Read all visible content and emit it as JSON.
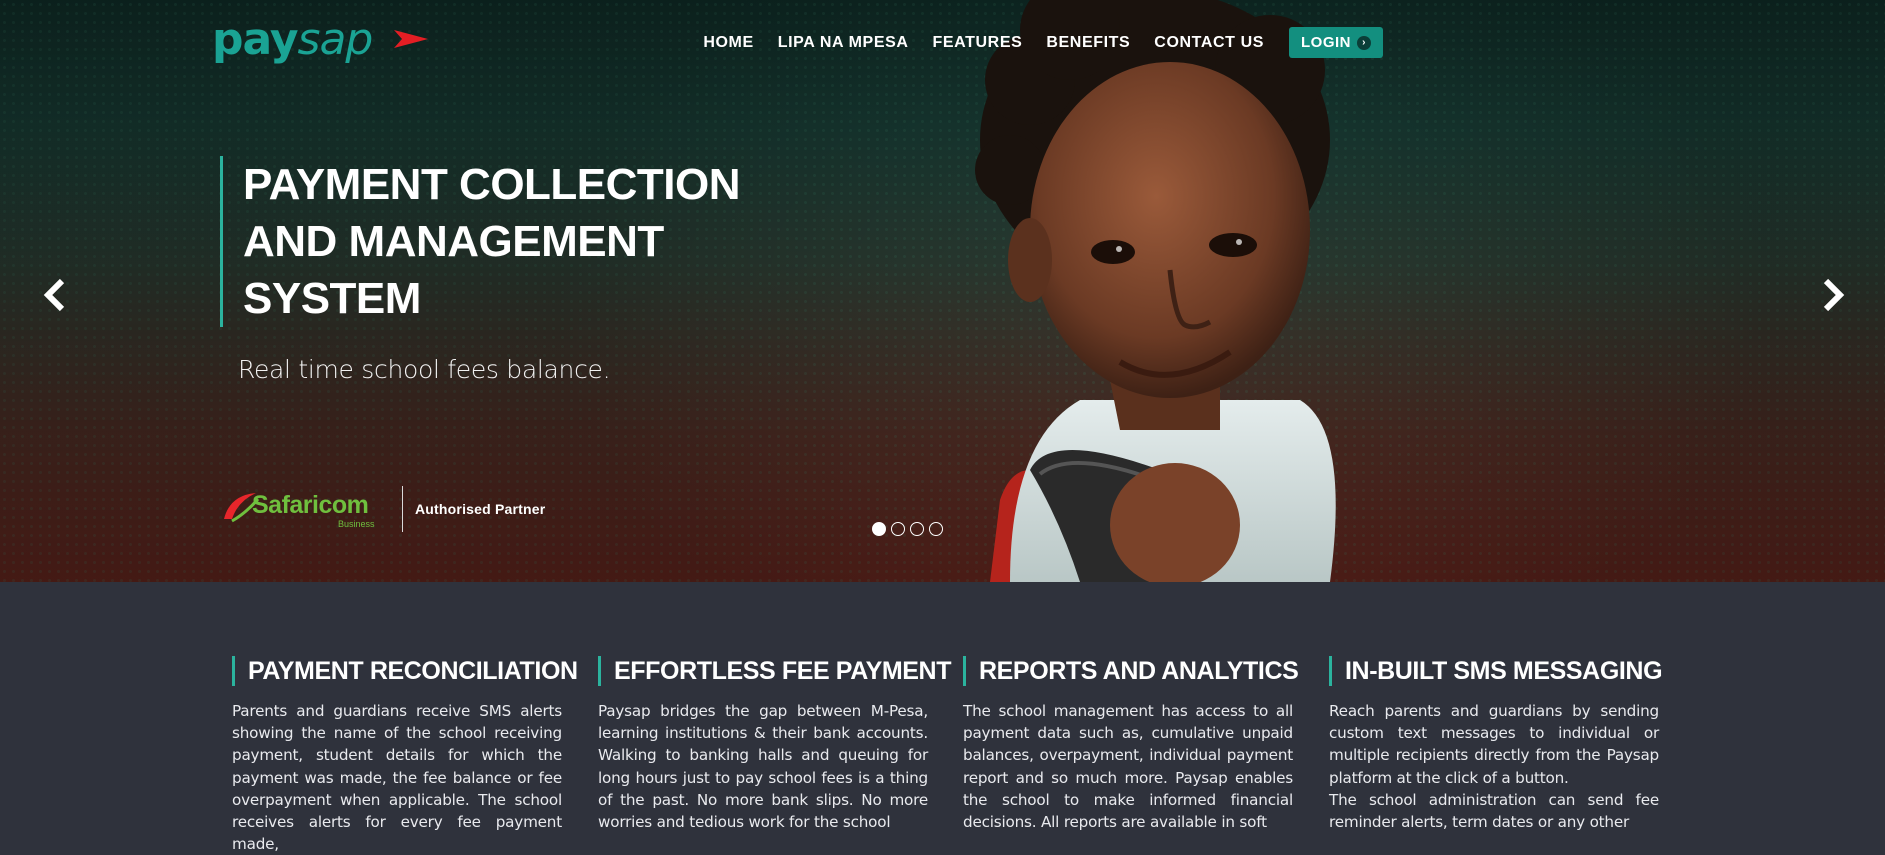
{
  "brand": {
    "logo_main": "pay",
    "logo_accent": "sap",
    "color_primary": "#1aa394",
    "color_accent_red": "#e31e24"
  },
  "nav": {
    "items": [
      "HOME",
      "LIPA NA MPESA",
      "FEATURES",
      "BENEFITS",
      "CONTACT US"
    ],
    "login_label": "LOGIN",
    "login_icon": "chevron-circle-right-icon"
  },
  "hero": {
    "headline": "PAYMENT COLLECTION AND MANAGEMENT SYSTEM",
    "subline": "Real time school fees balance.",
    "partner_name": "Safaricom",
    "partner_sub": "Business",
    "partner_label": "Authorised Partner",
    "slides_total": 4,
    "active_slide": 1,
    "prev_icon": "chevron-left-icon",
    "next_icon": "chevron-right-icon"
  },
  "features": [
    {
      "title": "PAYMENT RECONCILIATION",
      "body": "Parents and guardians receive SMS alerts showing the name of the school receiving payment, student details for which the payment was made, the fee balance or fee overpayment when applicable. The school receives alerts for every fee payment made,"
    },
    {
      "title": "EFFORTLESS FEE PAYMENT",
      "body": "Paysap bridges the gap between M-Pesa, learning institutions & their bank accounts. Walking to banking halls and queuing for long hours just to pay school fees is a thing of the past. No more bank slips. No more worries and tedious work for the school"
    },
    {
      "title": "REPORTS AND ANALYTICS",
      "body": "The school management has access to all payment data such as, cumulative unpaid balances, overpayment, individual payment report and so much more. Paysap enables the school to make informed financial decisions. All reports are available in soft"
    },
    {
      "title": "IN-BUILT SMS MESSAGING",
      "body": "Reach parents and guardians by sending custom text messages to individual or multiple recipients directly from the Paysap platform at the click of a button.\nThe school administration can send fee reminder alerts, term dates or any other"
    }
  ]
}
